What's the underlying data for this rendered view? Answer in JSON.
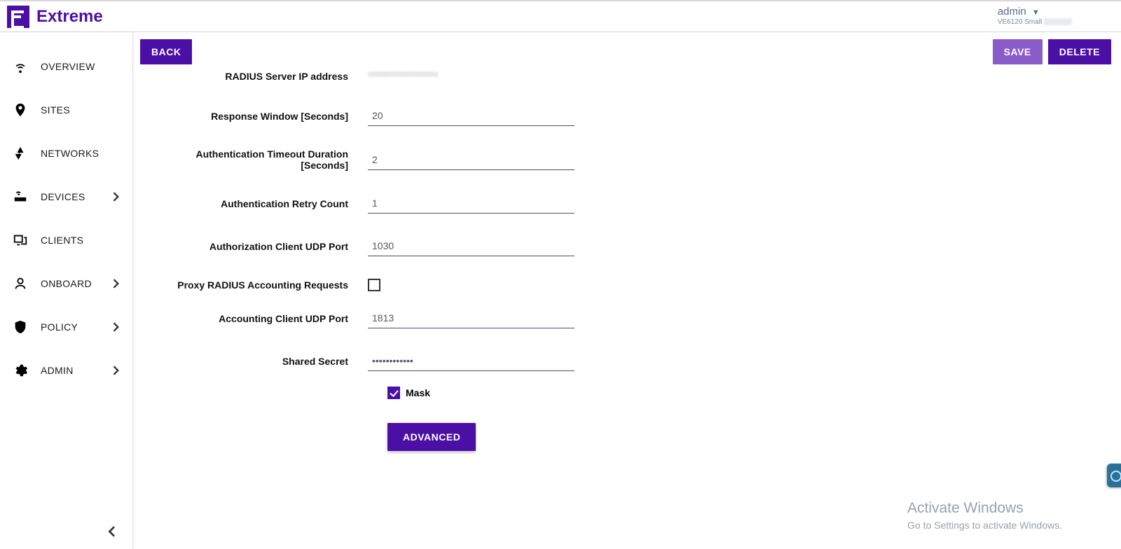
{
  "brand": {
    "name": "Extreme"
  },
  "user": {
    "name": "admin",
    "appliance": "VE6120 Small"
  },
  "sidebar": {
    "items": [
      {
        "label": "OVERVIEW",
        "expandable": false
      },
      {
        "label": "SITES",
        "expandable": false
      },
      {
        "label": "NETWORKS",
        "expandable": false
      },
      {
        "label": "DEVICES",
        "expandable": true
      },
      {
        "label": "CLIENTS",
        "expandable": false
      },
      {
        "label": "ONBOARD",
        "expandable": true
      },
      {
        "label": "POLICY",
        "expandable": true
      },
      {
        "label": "ADMIN",
        "expandable": true
      }
    ]
  },
  "buttons": {
    "back": "BACK",
    "save": "SAVE",
    "delete": "DELETE",
    "advanced": "ADVANCED"
  },
  "form": {
    "serverIpLabel": "RADIUS Server IP address",
    "serverIp": "",
    "responseWindowLabel": "Response Window [Seconds]",
    "responseWindow": "20",
    "authTimeoutLabel": "Authentication Timeout Duration [Seconds]",
    "authTimeout": "2",
    "retryCountLabel": "Authentication Retry Count",
    "retryCount": "1",
    "authzPortLabel": "Authorization Client UDP Port",
    "authzPort": "1030",
    "proxyAcctLabel": "Proxy RADIUS Accounting Requests",
    "proxyAcct": false,
    "acctPortLabel": "Accounting Client UDP Port",
    "acctPort": "1813",
    "sharedSecretLabel": "Shared Secret",
    "sharedSecret": "••••••••••••",
    "maskLabel": "Mask",
    "maskChecked": true
  },
  "watermark": {
    "line1": "Activate Windows",
    "line2": "Go to Settings to activate Windows."
  }
}
